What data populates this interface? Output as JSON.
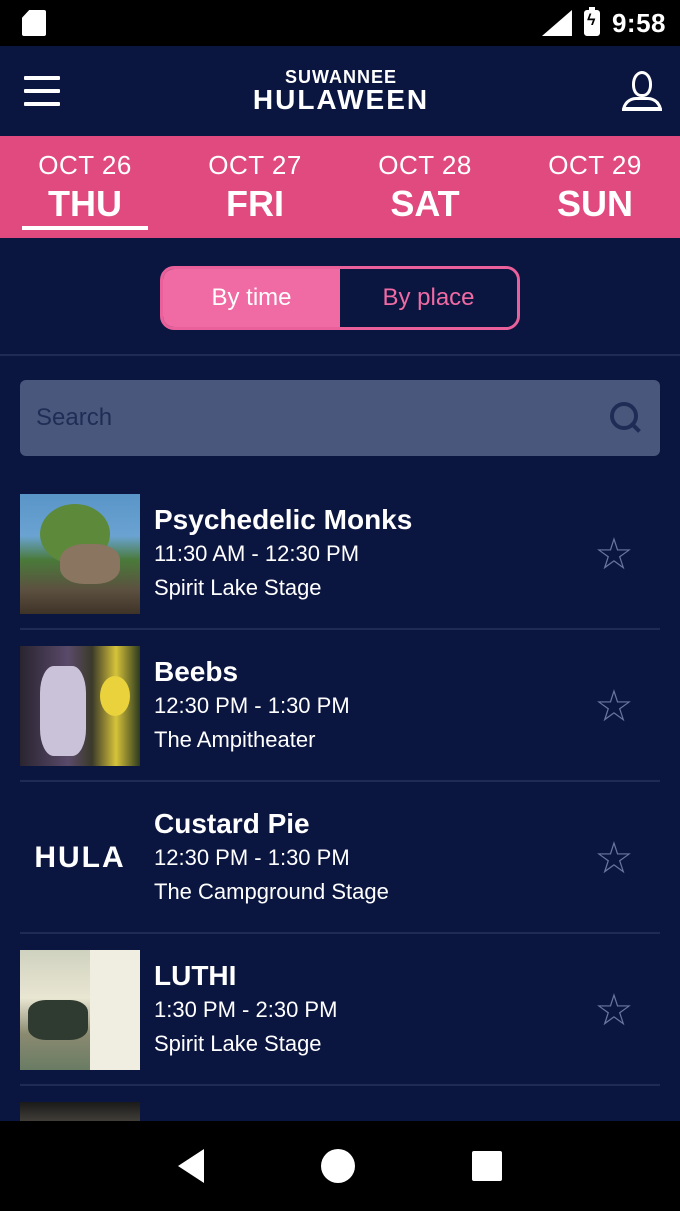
{
  "status_bar": {
    "time": "9:58",
    "icons": [
      "sd-card-icon",
      "signal-icon",
      "battery-icon"
    ]
  },
  "app_bar": {
    "logo_line1": "SUWANNEE",
    "logo_line2": "HULAWEEN",
    "menu_icon": "menu-icon",
    "profile_icon": "profile-icon"
  },
  "days": [
    {
      "date": "OCT 26",
      "name": "THU",
      "active": true
    },
    {
      "date": "OCT 27",
      "name": "FRI",
      "active": false
    },
    {
      "date": "OCT 28",
      "name": "SAT",
      "active": false
    },
    {
      "date": "OCT 29",
      "name": "SUN",
      "active": false
    }
  ],
  "view_toggle": {
    "by_time": "By time",
    "by_place": "By place",
    "selected": "by_time"
  },
  "search": {
    "placeholder": "Search"
  },
  "schedule": [
    {
      "artist": "Psychedelic Monks",
      "time": "11:30 AM - 12:30 PM",
      "stage": "Spirit Lake Stage",
      "favorite": false
    },
    {
      "artist": "Beebs",
      "time": "12:30 PM - 1:30 PM",
      "stage": "The Ampitheater",
      "favorite": false
    },
    {
      "artist": "Custard Pie",
      "time": "12:30 PM - 1:30 PM",
      "stage": "The Campground Stage",
      "favorite": false,
      "logo_text": "HULA"
    },
    {
      "artist": "LUTHI",
      "time": "1:30 PM - 2:30 PM",
      "stage": "Spirit Lake Stage",
      "favorite": false
    }
  ],
  "colors": {
    "background": "#0b1640",
    "accent_pink": "#e04a7e",
    "toggle_pink": "#f06aa3",
    "search_bg": "#4a577c"
  }
}
